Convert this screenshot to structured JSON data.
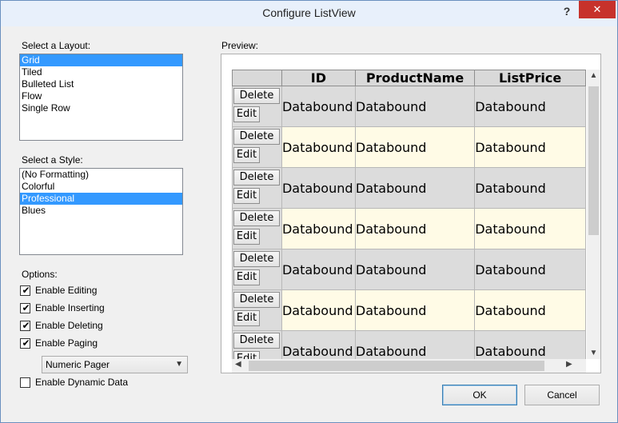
{
  "window": {
    "title": "Configure ListView",
    "help": "?",
    "close": "✕"
  },
  "layout": {
    "label": "Select a Layout:",
    "items": [
      "Grid",
      "Tiled",
      "Bulleted List",
      "Flow",
      "Single Row"
    ],
    "selected": 0
  },
  "style": {
    "label": "Select a Style:",
    "items": [
      "(No Formatting)",
      "Colorful",
      "Professional",
      "Blues"
    ],
    "selected": 2
  },
  "options": {
    "label": "Options:",
    "enable_editing": {
      "label": "Enable Editing",
      "checked": true
    },
    "enable_inserting": {
      "label": "Enable Inserting",
      "checked": true
    },
    "enable_deleting": {
      "label": "Enable Deleting",
      "checked": true
    },
    "enable_paging": {
      "label": "Enable Paging",
      "checked": true
    },
    "pager": {
      "value": "Numeric Pager"
    },
    "enable_dynamic_data": {
      "label": "Enable Dynamic Data",
      "checked": false
    }
  },
  "preview": {
    "label": "Preview:",
    "columns": [
      "ID",
      "ProductName",
      "ListPrice"
    ],
    "delete_label": "Delete",
    "edit_label": "Edit",
    "rows": [
      [
        "Databound",
        "Databound",
        "Databound"
      ],
      [
        "Databound",
        "Databound",
        "Databound"
      ],
      [
        "Databound",
        "Databound",
        "Databound"
      ],
      [
        "Databound",
        "Databound",
        "Databound"
      ],
      [
        "Databound",
        "Databound",
        "Databound"
      ],
      [
        "Databound",
        "Databound",
        "Databound"
      ],
      [
        "Databound",
        "Databound",
        "Databound"
      ]
    ]
  },
  "buttons": {
    "ok": "OK",
    "cancel": "Cancel"
  },
  "icons": {
    "help": "help-icon",
    "close": "close-icon",
    "checkmark": "checkmark-icon",
    "dropdown": "chevron-down-icon",
    "scroll_up": "arrow-up-icon",
    "scroll_down": "arrow-down-icon",
    "scroll_left": "arrow-left-icon",
    "scroll_right": "arrow-right-icon"
  },
  "colors": {
    "selection": "#3399ff",
    "close_button": "#c7322b",
    "alt_row": "#fffbe6",
    "header_row": "#d9d9d9"
  }
}
